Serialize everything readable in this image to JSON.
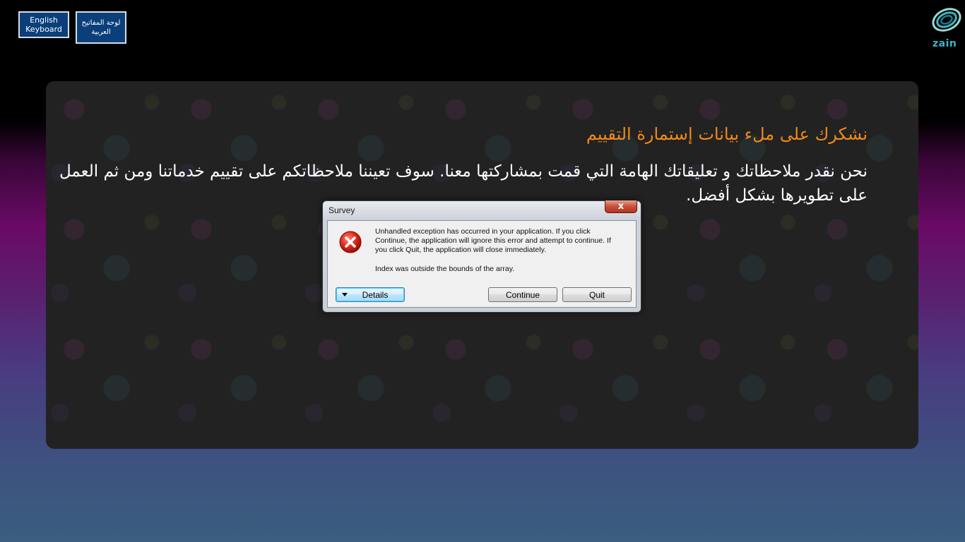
{
  "header": {
    "english_keyboard": "English\nKeyboard",
    "arabic_keyboard": "لوحة المفاتيح\nالعربية",
    "logo_text": "zain"
  },
  "main": {
    "title": "نشكرك على ملء بيانات إستمارة التقييم",
    "body": "نحن نقدر ملاحظاتك و تعليقاتك الهامة التي قمت بمشاركتها معنا. سوف تعيننا ملاحظاتكم على تقييم خدماتنا ومن ثم العمل على تطويرها بشكل أفضل."
  },
  "dialog": {
    "title": "Survey",
    "close_label": "x",
    "message": "Unhandled exception has occurred in your application. If you click Continue, the application will ignore this error and attempt to continue. If you click Quit, the application will close immediately.",
    "detail": "Index was outside the bounds of the array.",
    "details_button": "Details",
    "continue_button": "Continue",
    "quit_button": "Quit",
    "icon": "error-icon"
  },
  "colors": {
    "title_orange": "#f08a1a",
    "keyboard_button": "#0b3f7a",
    "logo_teal": "#3fb3c4"
  }
}
